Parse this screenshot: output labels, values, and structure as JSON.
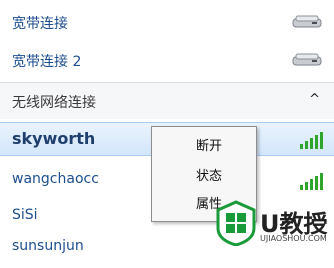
{
  "dialup": [
    {
      "label": "宽带连接"
    },
    {
      "label": "宽带连接 2"
    }
  ],
  "section": {
    "title": "无线网络连接",
    "chevron": "^"
  },
  "networks": [
    {
      "label": "skyworth",
      "selected": true
    },
    {
      "label": "wangchaocc"
    },
    {
      "label": "SiSi"
    },
    {
      "label": "sunsunjun"
    }
  ],
  "context_menu": {
    "items": [
      {
        "label": "断开"
      },
      {
        "label": "状态"
      },
      {
        "label": "属性"
      }
    ]
  },
  "watermark": {
    "brand": "U教授",
    "url": "UJIAOSHOU.COM"
  },
  "colors": {
    "link": "#1d4e8f",
    "signal": "#2fa52b",
    "selection": "#d3e6fb",
    "logo_green": "#1a9b3a"
  },
  "icons": [
    "network-drive-icon",
    "chevron-up-icon",
    "wifi-signal-icon",
    "windows-logo-icon"
  ]
}
